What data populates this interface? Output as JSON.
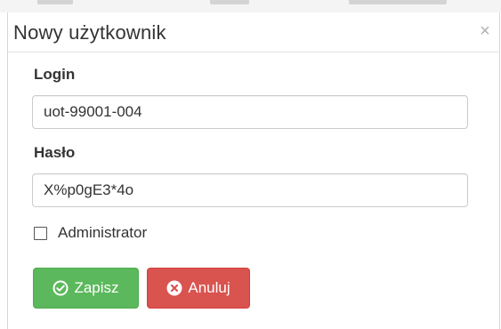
{
  "modal": {
    "title": "Nowy użytkownik",
    "close_symbol": "×"
  },
  "form": {
    "login": {
      "label": "Login",
      "value": "uot-99001-004"
    },
    "password": {
      "label": "Hasło",
      "value": "X%p0gE3*4o"
    },
    "admin_checkbox": {
      "label": "Administrator",
      "checked": false
    }
  },
  "buttons": {
    "save": {
      "label": "Zapisz",
      "icon": "check-circle-icon",
      "color": "#5cb85c"
    },
    "cancel": {
      "label": "Anuluj",
      "icon": "times-circle-icon",
      "color": "#d9534f"
    }
  }
}
